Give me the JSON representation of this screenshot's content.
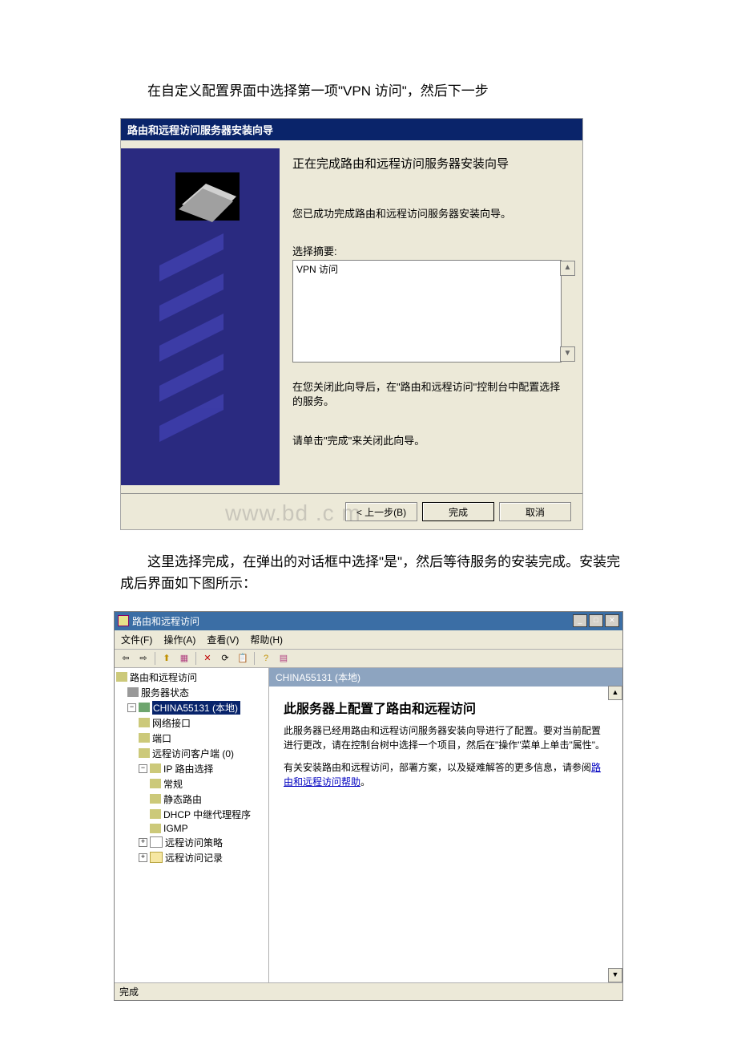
{
  "narrative": {
    "p1": "在自定义配置界面中选择第一项\"VPN 访问\"，然后下一步",
    "p2": "这里选择完成，在弹出的对话框中选择\"是\"，然后等待服务的安装完成。安装完成后界面如下图所示："
  },
  "wizard": {
    "title": "路由和远程访问服务器安装向导",
    "heading": "正在完成路由和远程访问服务器安装向导",
    "success": "您已成功完成路由和远程访问服务器安装向导。",
    "summary_label": "选择摘要:",
    "summary_value": "VPN 访问",
    "after_close": "在您关闭此向导后，在\"路由和远程访问\"控制台中配置选择的服务。",
    "click_finish": "请单击\"完成\"来关闭此向导。",
    "buttons": {
      "back": "< 上一步(B)",
      "finish": "完成",
      "cancel": "取消"
    },
    "watermark": "www.bd   .c m"
  },
  "console": {
    "title": "路由和远程访问",
    "menu": {
      "file": "文件(F)",
      "action": "操作(A)",
      "view": "查看(V)",
      "help": "帮助(H)"
    },
    "tree": {
      "root": "路由和远程访问",
      "server_status": "服务器状态",
      "host": "CHINA55131 (本地)",
      "network_if": "网络接口",
      "ports": "端口",
      "remote_clients": "远程访问客户端 (0)",
      "ip_routing": "IP 路由选择",
      "general": "常规",
      "static": "静态路由",
      "dhcp_relay": "DHCP 中继代理程序",
      "igmp": "IGMP",
      "remote_policies": "远程访问策略",
      "remote_logs": "远程访问记录"
    },
    "content": {
      "header": "CHINA55131 (本地)",
      "h2": "此服务器上配置了路由和远程访问",
      "p1": "此服务器已经用路由和远程访问服务器安装向导进行了配置。要对当前配置进行更改，请在控制台树中选择一个项目，然后在\"操作\"菜单上单击\"属性\"。",
      "p2a": "有关安装路由和远程访问，部署方案，以及疑难解答的更多信息，请参阅",
      "link": "路由和远程访问帮助",
      "p2b": "。"
    },
    "status": "完成"
  }
}
